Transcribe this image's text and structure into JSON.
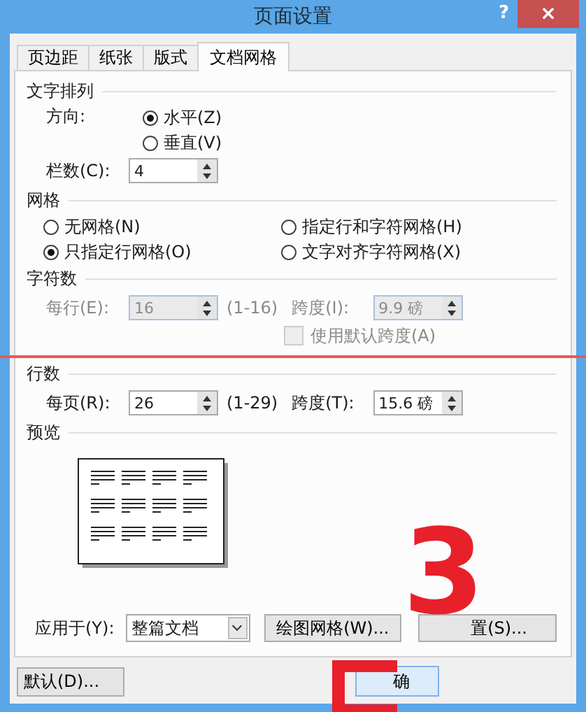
{
  "window": {
    "title": "页面设置",
    "help": "?",
    "close": "×"
  },
  "tabs": [
    {
      "label": "页边距",
      "selected": false
    },
    {
      "label": "纸张",
      "selected": false
    },
    {
      "label": "版式",
      "selected": false
    },
    {
      "label": "文档网格",
      "selected": true
    }
  ],
  "text_direction": {
    "heading": "文字排列",
    "direction_label": "方向:",
    "options": [
      {
        "label": "水平(Z)",
        "selected": true
      },
      {
        "label": "垂直(V)",
        "selected": false
      }
    ],
    "columns_label": "栏数(C):",
    "columns_value": "4"
  },
  "grid": {
    "heading": "网格",
    "options": [
      {
        "label": "无网格(N)",
        "selected": false
      },
      {
        "label": "指定行和字符网格(H)",
        "selected": false
      },
      {
        "label": "只指定行网格(O)",
        "selected": true
      },
      {
        "label": "文字对齐字符网格(X)",
        "selected": false
      }
    ]
  },
  "characters": {
    "heading": "字符数",
    "disabled": true,
    "per_line_label": "每行(E):",
    "per_line_value": "16",
    "range": "(1-16)",
    "pitch_label": "跨度(I):",
    "pitch_value": "9.9 磅",
    "default_pitch": {
      "label": "使用默认跨度(A)",
      "checked": false
    }
  },
  "lines": {
    "heading": "行数",
    "per_page_label": "每页(R):",
    "per_page_value": "26",
    "range": "(1-29)",
    "pitch_label": "跨度(T):",
    "pitch_value": "15.6 磅"
  },
  "preview": {
    "heading": "预览"
  },
  "apply_to": {
    "label": "应用于(Y):",
    "value": "整篇文档"
  },
  "buttons": {
    "drawing_grid": "绘图网格(W)...",
    "settings": "置(S)...",
    "default": "默认(D)...",
    "ok": "确"
  },
  "annotations": {
    "step": "3"
  }
}
